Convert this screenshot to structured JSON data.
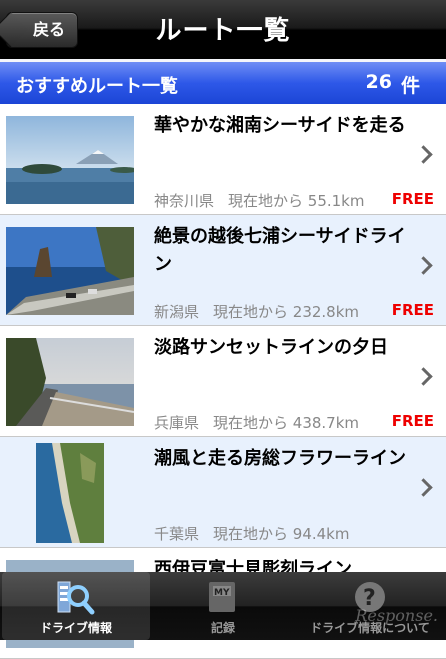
{
  "nav": {
    "back_label": "戻る",
    "title": "ルート一覧"
  },
  "section": {
    "title": "おすすめルート一覧",
    "count": "26",
    "unit": "件"
  },
  "routes": [
    {
      "name": "華やかな湘南シーサイドを走る",
      "prefecture": "神奈川県",
      "distance": "現在地から 55.1km",
      "price": "FREE"
    },
    {
      "name": "絶景の越後七浦シーサイドライン",
      "prefecture": "新潟県",
      "distance": "現在地から 232.8km",
      "price": "FREE"
    },
    {
      "name": "淡路サンセットラインの夕日",
      "prefecture": "兵庫県",
      "distance": "現在地から 438.7km",
      "price": "FREE"
    },
    {
      "name": "潮風と走る房総フラワーライン",
      "prefecture": "千葉県",
      "distance": "現在地から 94.4km",
      "price": ""
    },
    {
      "name": "西伊豆富士見彫刻ライン",
      "prefecture": "",
      "distance": "",
      "price": ""
    }
  ],
  "tabs": [
    {
      "label": "ドライブ情報",
      "icon": "drive-info-icon",
      "active": true
    },
    {
      "label": "記録",
      "icon": "record-icon",
      "active": false
    },
    {
      "label": "ドライブ情報について",
      "icon": "help-icon",
      "active": false
    }
  ],
  "watermark": "Response."
}
